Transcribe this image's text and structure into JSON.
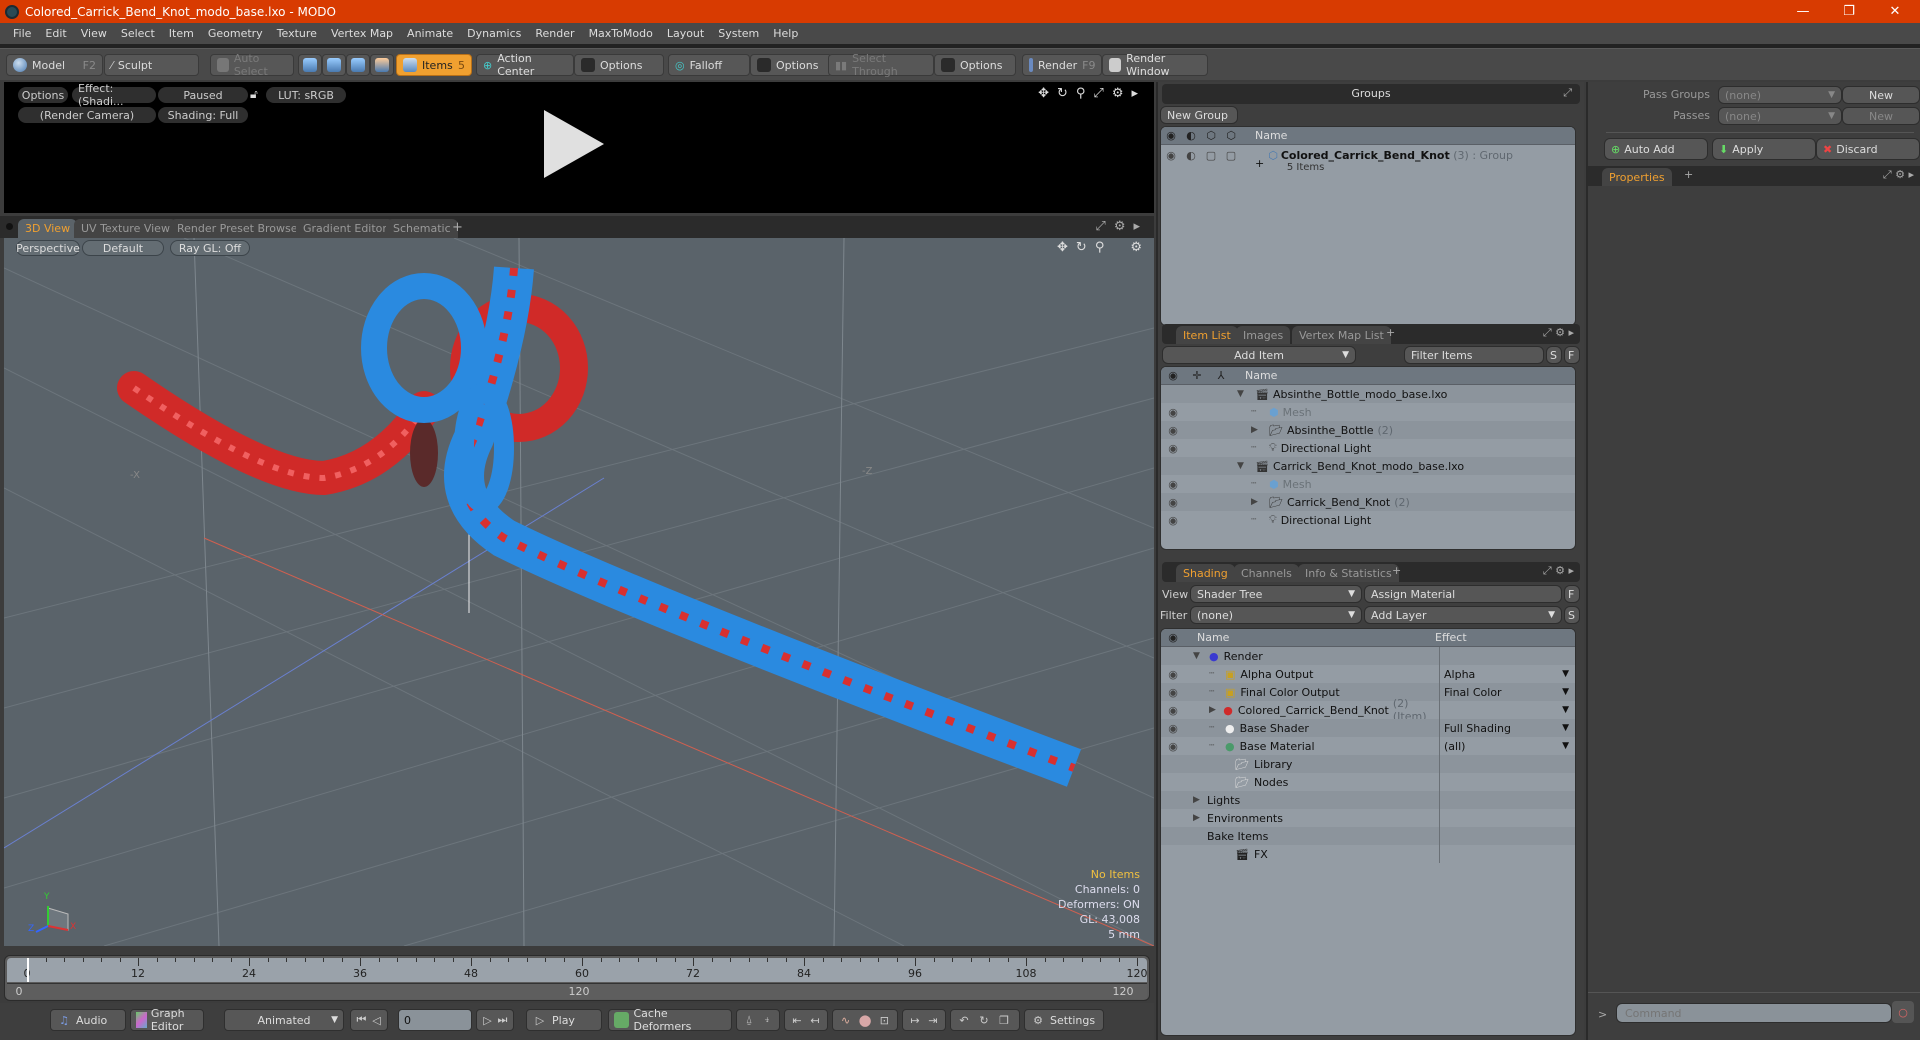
{
  "window": {
    "title": "Colored_Carrick_Bend_Knot_modo_base.lxo - MODO",
    "minimize": "—",
    "restore": "❐",
    "close": "✕"
  },
  "menu": [
    "File",
    "Edit",
    "View",
    "Select",
    "Item",
    "Geometry",
    "Texture",
    "Vertex Map",
    "Animate",
    "Dynamics",
    "Render",
    "MaxToModo",
    "Layout",
    "System",
    "Help"
  ],
  "toolbar": {
    "model": "Model",
    "model_key": "F2",
    "sculpt": "Sculpt",
    "auto_select": "Auto Select",
    "items": "Items",
    "items_key": "5",
    "action_center": "Action Center",
    "options1": "Options",
    "falloff": "Falloff",
    "options2": "Options",
    "select_through": "Select Through",
    "options3": "Options",
    "render": "Render",
    "render_key": "F9",
    "render_window": "Render Window"
  },
  "preview": {
    "options": "Options",
    "effect": "Effect: (Shadi...",
    "paused": "Paused",
    "lut": "LUT: sRGB",
    "camera": "(Render Camera)",
    "shading": "Shading: Full"
  },
  "viewport_tabs": [
    {
      "label": "3D View",
      "active": true
    },
    {
      "label": "UV Texture View"
    },
    {
      "label": "Render Preset Browser"
    },
    {
      "label": "Gradient Editor"
    },
    {
      "label": "Schematic"
    }
  ],
  "viewport": {
    "perspective": "Perspective",
    "default": "Default",
    "raygl": "Ray GL: Off",
    "axis_x": "-X",
    "axis_z": "-Z",
    "stats": {
      "items": "No Items",
      "channels": "Channels: 0",
      "deformers": "Deformers: ON",
      "gl": "GL: 43,008",
      "unit": "5 mm"
    },
    "gizmo": {
      "x": "X",
      "y": "Y",
      "z": "Z"
    }
  },
  "timeline": {
    "ticks": [
      "0",
      "12",
      "24",
      "36",
      "48",
      "60",
      "72",
      "84",
      "96",
      "108",
      "120"
    ],
    "range_start": "0",
    "range_mid": "120",
    "range_end": "120",
    "current": 0,
    "max": 120
  },
  "bottombar": {
    "audio": "Audio",
    "graph_editor": "Graph Editor",
    "animated": "Animated",
    "frame": "0",
    "play": "Play",
    "cache_deformers": "Cache Deformers",
    "settings": "Settings"
  },
  "groups": {
    "title": "Groups",
    "new_group": "New Group",
    "col_name": "Name",
    "rows": [
      {
        "name": "Colored_Carrick_Bend_Knot",
        "count": "(3)",
        "type": ": Group",
        "sub": "5 Items"
      }
    ]
  },
  "itemlist": {
    "tabs": [
      "Item List",
      "Images",
      "Vertex Map List"
    ],
    "add_item": "Add Item",
    "filter": "Filter Items",
    "s": "S",
    "f": "F",
    "col_name": "Name",
    "rows": [
      {
        "name": "Absinthe_Bottle_modo_base.lxo",
        "level": 0,
        "icon": "scene",
        "eye": false,
        "expand": "▼"
      },
      {
        "name": "Mesh",
        "level": 1,
        "icon": "mesh",
        "eye": true,
        "dim": true
      },
      {
        "name": "Absinthe_Bottle",
        "count": "(2)",
        "level": 1,
        "icon": "folder",
        "eye": true,
        "expand": "▶"
      },
      {
        "name": "Directional Light",
        "level": 1,
        "icon": "light",
        "eye": true
      },
      {
        "name": "Carrick_Bend_Knot_modo_base.lxo",
        "level": 0,
        "icon": "scene",
        "eye": false,
        "expand": "▼"
      },
      {
        "name": "Mesh",
        "level": 1,
        "icon": "mesh",
        "eye": true,
        "dim": true
      },
      {
        "name": "Carrick_Bend_Knot",
        "count": "(2)",
        "level": 1,
        "icon": "folder",
        "eye": true,
        "expand": "▶"
      },
      {
        "name": "Directional Light",
        "level": 1,
        "icon": "light",
        "eye": true
      }
    ]
  },
  "shading": {
    "tabs": [
      "Shading",
      "Channels",
      "Info & Statistics"
    ],
    "view_label": "View",
    "view_value": "Shader Tree",
    "assign_material": "Assign Material",
    "f": "F",
    "filter_label": "Filter",
    "filter_value": "(none)",
    "add_layer": "Add Layer",
    "s": "S",
    "col_name": "Name",
    "col_effect": "Effect",
    "rows": [
      {
        "name": "Render",
        "level": 0,
        "icon": "render",
        "eye": false,
        "expand": "▼",
        "effect": ""
      },
      {
        "name": "Alpha Output",
        "level": 1,
        "icon": "output",
        "eye": true,
        "effect": "Alpha",
        "dd": true
      },
      {
        "name": "Final Color Output",
        "level": 1,
        "icon": "output",
        "eye": true,
        "effect": "Final Color",
        "dd": true
      },
      {
        "name": "Colored_Carrick_Bend_Knot",
        "count": "(2) (Item)",
        "level": 1,
        "icon": "material-group",
        "eye": true,
        "expand": "▶",
        "effect": "",
        "dd": true
      },
      {
        "name": "Base Shader",
        "level": 1,
        "icon": "shader",
        "eye": true,
        "effect": "Full Shading",
        "dd": true
      },
      {
        "name": "Base Material",
        "level": 1,
        "icon": "material",
        "eye": true,
        "effect": "(all)",
        "dd": true
      },
      {
        "name": "Library",
        "level": 0.5,
        "icon": "folder",
        "eye": false,
        "effect": ""
      },
      {
        "name": "Nodes",
        "level": 0.5,
        "icon": "folder",
        "eye": false,
        "effect": ""
      },
      {
        "name": "Lights",
        "level": 0,
        "icon": "",
        "eye": false,
        "expand": "▶",
        "effect": ""
      },
      {
        "name": "Environments",
        "level": 0,
        "icon": "",
        "eye": false,
        "expand": "▶",
        "effect": ""
      },
      {
        "name": "Bake Items",
        "level": 0,
        "icon": "",
        "eye": false,
        "effect": ""
      },
      {
        "name": "FX",
        "level": 0.5,
        "icon": "scene",
        "eye": false,
        "effect": ""
      }
    ]
  },
  "passes": {
    "pass_groups_label": "Pass Groups",
    "pass_groups_value": "(none)",
    "new1": "New",
    "passes_label": "Passes",
    "passes_value": "(none)",
    "new2": "New",
    "auto_add": "Auto Add",
    "apply": "Apply",
    "discard": "Discard",
    "properties_tab": "Properties"
  },
  "command": {
    "prompt": ">",
    "placeholder": "Command"
  }
}
